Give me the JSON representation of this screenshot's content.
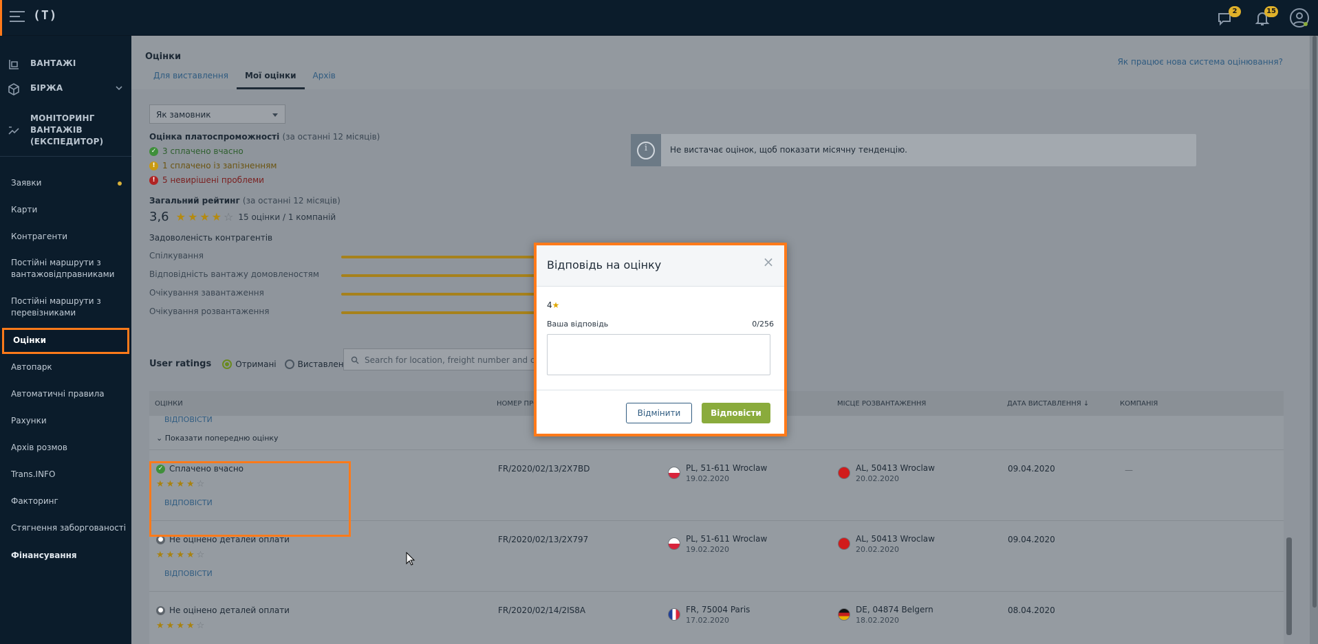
{
  "topbar": {
    "logo": "(T)",
    "messages_badge": "2",
    "notifications_badge": "15"
  },
  "sidebar": {
    "top_items": [
      {
        "label": "ВАНТАЖІ",
        "icon": "cargo-icon"
      },
      {
        "label": "БІРЖА",
        "icon": "exchange-icon"
      },
      {
        "label": "МОНІТОРИНГ ВАНТАЖІВ (ЕКСПЕДИТОР)",
        "icon": "monitoring-icon"
      }
    ],
    "items": [
      {
        "label": "Заявки"
      },
      {
        "label": "Карти"
      },
      {
        "label": "Контрагенти"
      },
      {
        "label": "Постійні маршрути з вантажовідправниками"
      },
      {
        "label": "Постійні маршрути з перевізниками"
      },
      {
        "label": "Оцінки"
      },
      {
        "label": "Автопарк"
      },
      {
        "label": "Автоматичні правила"
      },
      {
        "label": "Рахунки"
      },
      {
        "label": "Архів розмов"
      },
      {
        "label": "Trans.INFO"
      },
      {
        "label": "Факторинг"
      },
      {
        "label": "Стягнення заборгованості"
      },
      {
        "label": "Фінансування"
      }
    ]
  },
  "page": {
    "title": "Оцінки",
    "help_link": "Як працює нова система оцінювання?",
    "tabs": [
      {
        "label": "Для виставлення"
      },
      {
        "label": "Мої оцінки"
      },
      {
        "label": "Архів"
      }
    ],
    "role_select": "Як замовник"
  },
  "solvency": {
    "title": "Оцінка платоспроможності",
    "period": "(за останні 12 місяців)",
    "rows": [
      {
        "text": "3 сплачено вчасно"
      },
      {
        "text": "1 сплачено із запізненням"
      },
      {
        "text": "5 невирішені проблеми"
      }
    ]
  },
  "overall": {
    "title": "Загальний рейтинг",
    "period": "(за останні 12 місяців)",
    "value": "3,6",
    "stars": 3.5,
    "count": "15 оцінки / 1 компаній"
  },
  "satisfaction": {
    "title": "Задоволеність контрагентів",
    "rows": [
      {
        "label": "Спілкування"
      },
      {
        "label": "Відповідність вантажу домовленостям"
      },
      {
        "label": "Очікування завантаження"
      },
      {
        "label": "Очікування розвантаження"
      }
    ]
  },
  "info_box": {
    "text": "Не вистачає оцінок, щоб показати місячну тенденцію."
  },
  "user_ratings": {
    "label": "User ratings",
    "radio_received": "Отримані",
    "radio_given": "Виставлені",
    "search_placeholder": "Search for location, freight number and com..."
  },
  "table": {
    "headers": {
      "ratings": "ОЦІНКИ",
      "number": "НОМЕР ПРО",
      "unload": "МІСЦЕ РОЗВАНТАЖЕННЯ",
      "date": "ДАТА ВИСТАВЛЕННЯ ↓",
      "company": "КОМПАНІЯ"
    },
    "reply_link": "ВІДПОВІСТИ",
    "show_previous": "Показати попередню оцінку",
    "rows": [
      {
        "status": "Сплачено вчасно",
        "status_color": "#3f8f3a",
        "stars": 4,
        "number": "FR/2020/02/13/2X7BD",
        "load_place": "PL, 51-611 Wroclaw",
        "load_date": "19.02.2020",
        "unload_place": "AL, 50413 Wroclaw",
        "unload_date": "20.02.2020",
        "date": "09.04.2020",
        "company": "—",
        "reply": "ВІДПОВІСТИ"
      },
      {
        "status": "Не оцінено деталей оплати",
        "status_color": "#5e656c",
        "stars": 4,
        "number": "FR/2020/02/13/2X797",
        "load_place": "PL, 51-611 Wroclaw",
        "load_date": "19.02.2020",
        "unload_place": "AL, 50413 Wroclaw",
        "unload_date": "20.02.2020",
        "date": "09.04.2020",
        "company": "",
        "reply": "ВІДПОВІСТИ"
      },
      {
        "status": "Не оцінено деталей оплати",
        "status_color": "#5e656c",
        "stars": 4,
        "number": "FR/2020/02/14/2IS8A",
        "load_place": "FR, 75004 Paris",
        "load_date": "17.02.2020",
        "unload_place": "DE, 04874 Belgern",
        "unload_date": "18.02.2020",
        "date": "08.04.2020",
        "company": "",
        "reply": ""
      }
    ]
  },
  "modal": {
    "title": "Відповідь на оцінку",
    "rating": "4",
    "answer_label": "Ваша відповідь",
    "counter": "0/256",
    "textarea_value": "",
    "cancel_label": "Відмінити",
    "reply_label": "Відповісти"
  },
  "colors": {
    "accent": "#ff7a1a",
    "primary_button": "#8aab3c",
    "link": "#2f5b80",
    "star": "#e0a800"
  }
}
